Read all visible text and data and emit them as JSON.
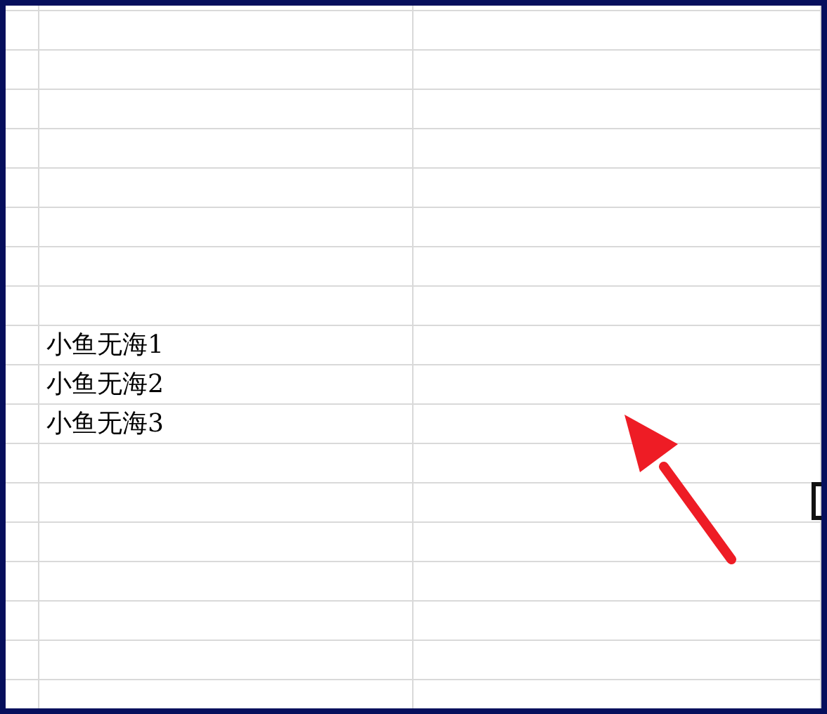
{
  "sheet": {
    "cells": [
      {
        "text": "小鱼无海1"
      },
      {
        "text": "小鱼无海2"
      },
      {
        "text": "小鱼无海3"
      }
    ]
  }
}
